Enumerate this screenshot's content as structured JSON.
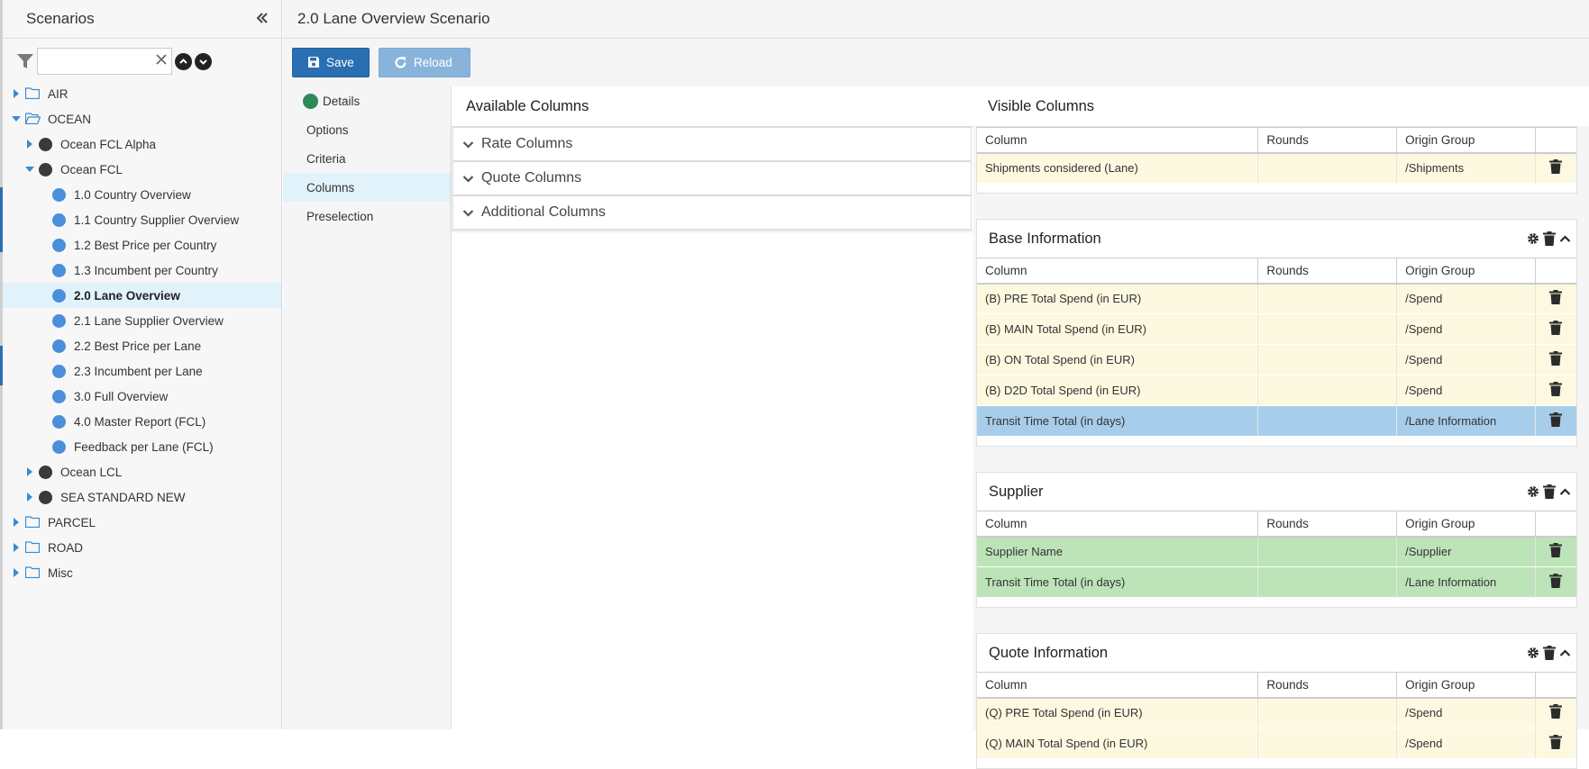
{
  "sidebar": {
    "title": "Scenarios",
    "search_value": "",
    "search_placeholder": "",
    "tree": [
      {
        "label": "AIR",
        "type": "folder",
        "level": 0,
        "caret": "right"
      },
      {
        "label": "OCEAN",
        "type": "folder-open",
        "level": 0,
        "caret": "down"
      },
      {
        "label": "Ocean FCL Alpha",
        "type": "dot-dark",
        "level": 1,
        "caret": "right"
      },
      {
        "label": "Ocean FCL",
        "type": "dot-dark",
        "level": 1,
        "caret": "down"
      },
      {
        "label": "1.0 Country Overview",
        "type": "dot-blue",
        "level": 2,
        "caret": "none"
      },
      {
        "label": "1.1 Country Supplier Overview",
        "type": "dot-blue",
        "level": 2,
        "caret": "none"
      },
      {
        "label": "1.2 Best Price per Country",
        "type": "dot-blue",
        "level": 2,
        "caret": "none"
      },
      {
        "label": "1.3 Incumbent per Country",
        "type": "dot-blue",
        "level": 2,
        "caret": "none"
      },
      {
        "label": "2.0 Lane Overview",
        "type": "dot-blue",
        "level": 2,
        "caret": "none",
        "selected": true
      },
      {
        "label": "2.1 Lane Supplier Overview",
        "type": "dot-blue",
        "level": 2,
        "caret": "none"
      },
      {
        "label": "2.2 Best Price per Lane",
        "type": "dot-blue",
        "level": 2,
        "caret": "none"
      },
      {
        "label": "2.3 Incumbent per Lane",
        "type": "dot-blue",
        "level": 2,
        "caret": "none"
      },
      {
        "label": "3.0 Full Overview",
        "type": "dot-blue",
        "level": 2,
        "caret": "none"
      },
      {
        "label": "4.0 Master Report (FCL)",
        "type": "dot-blue",
        "level": 2,
        "caret": "none"
      },
      {
        "label": "Feedback per Lane (FCL)",
        "type": "dot-blue",
        "level": 2,
        "caret": "none"
      },
      {
        "label": "Ocean LCL",
        "type": "dot-dark",
        "level": 1,
        "caret": "right"
      },
      {
        "label": "SEA STANDARD NEW",
        "type": "dot-dark",
        "level": 1,
        "caret": "right"
      },
      {
        "label": "PARCEL",
        "type": "folder",
        "level": 0,
        "caret": "right"
      },
      {
        "label": "ROAD",
        "type": "folder",
        "level": 0,
        "caret": "right"
      },
      {
        "label": "Misc",
        "type": "folder",
        "level": 0,
        "caret": "right"
      }
    ]
  },
  "header": {
    "title": "2.0 Lane Overview Scenario"
  },
  "toolbar": {
    "save_label": "Save",
    "reload_label": "Reload"
  },
  "subnav": [
    {
      "label": "Details",
      "status": "ok"
    },
    {
      "label": "Options"
    },
    {
      "label": "Criteria"
    },
    {
      "label": "Columns",
      "active": true
    },
    {
      "label": "Preselection"
    }
  ],
  "available": {
    "title": "Available Columns",
    "groups": [
      "Rate Columns",
      "Quote Columns",
      "Additional Columns"
    ]
  },
  "visible": {
    "title": "Visible Columns",
    "headers": {
      "column": "Column",
      "rounds": "Rounds",
      "origin": "Origin Group"
    },
    "top_rows": [
      {
        "column": "Shipments considered (Lane)",
        "rounds": "",
        "origin": "/Shipments",
        "color": "yellow"
      }
    ],
    "groups": [
      {
        "title": "Base Information",
        "rows": [
          {
            "column": "(B) PRE Total Spend (in EUR)",
            "rounds": "",
            "origin": "/Spend",
            "color": "yellow"
          },
          {
            "column": "(B) MAIN Total Spend (in EUR)",
            "rounds": "",
            "origin": "/Spend",
            "color": "yellow"
          },
          {
            "column": "(B) ON Total Spend (in EUR)",
            "rounds": "",
            "origin": "/Spend",
            "color": "yellow"
          },
          {
            "column": "(B) D2D Total Spend (in EUR)",
            "rounds": "",
            "origin": "/Spend",
            "color": "yellow"
          },
          {
            "column": "Transit Time Total (in days)",
            "rounds": "",
            "origin": "/Lane Information",
            "color": "blue"
          }
        ]
      },
      {
        "title": "Supplier",
        "rows": [
          {
            "column": "Supplier Name",
            "rounds": "",
            "origin": "/Supplier",
            "color": "green"
          },
          {
            "column": "Transit Time Total (in days)",
            "rounds": "",
            "origin": "/Lane Information",
            "color": "green"
          }
        ]
      },
      {
        "title": "Quote Information",
        "rows": [
          {
            "column": "(Q) PRE Total Spend (in EUR)",
            "rounds": "",
            "origin": "/Spend",
            "color": "yellow"
          },
          {
            "column": "(Q) MAIN Total Spend (in EUR)",
            "rounds": "",
            "origin": "/Spend",
            "color": "yellow"
          }
        ]
      }
    ]
  },
  "colors": {
    "primary": "#2a6fb2",
    "disabled": "#88b4dc",
    "selection": "#e2f2fb",
    "row_yellow": "#fdf9e0",
    "row_blue": "#a7cdea",
    "row_green": "#bde3b8"
  }
}
